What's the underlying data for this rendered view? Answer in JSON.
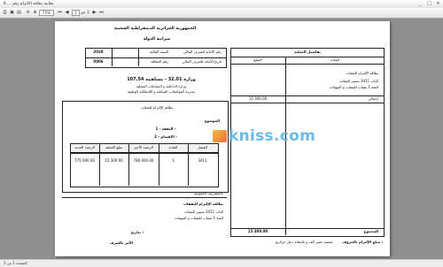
{
  "window": {
    "title": "معاينة بطاقة الالتزام رقم ... 6",
    "min": "_",
    "max": "□",
    "close": "✕"
  },
  "toolbar": {
    "zoom_value": "75%",
    "page_label": "من",
    "page_value": "1",
    "page_total": "1"
  },
  "status": {
    "page_indicator": "الصفحة 1 من 1"
  },
  "doc": {
    "republic": "الجمهورية الجزائرية الديمقراطية الشعبية",
    "budget_title": "ميزانية الدولة",
    "meta": [
      {
        "label": "رقم الأمانة للصرف المالي",
        "sublabel": "السنة المالية",
        "value": "2020"
      },
      {
        "label": "تاريخ الأمانة للصرف المالي",
        "sublabel": "رقم البطاقة",
        "value": "0006"
      }
    ],
    "ministry_line": "وزارة 32.01 - مساهمة 107.54",
    "ministry_sub1": "وزارة الداخلية و الجماعات المحلية",
    "ministry_sub2": "مديرية المواصلات السلكية و اللاسلكية الوطنية",
    "commit_card_box": "بطاقة الإلتزام للنفقات",
    "subject_label": "الموضوع",
    "part_line": "النفقة - 1 -",
    "section_line": "الاقسام - 2 -",
    "table_headers": [
      "الفصل",
      "المادة",
      "الرصيد الأخير",
      "مبلغ العملية",
      "الرصيد الجديد"
    ],
    "table_row": [
      "3411",
      "1",
      "780 000.00",
      "15 300.00",
      "775 000.00"
    ],
    "spending_label": "بالمصاريف العمومية",
    "card_title": "بطاقة الإلتزام للنفقات",
    "card_lines": [
      "الباب 3411 تسيير النفقات",
      "الفئة 1 نفقات للنفقات و المهمات"
    ],
    "date_label": "بتاريخ :",
    "orderer_label": "الآمر بالصرف",
    "right_panel_title": "تفاصيل العملية",
    "right_headers": [
      "المبلغ",
      "المادة"
    ],
    "right_entry_title": "بطاقة الإلتزام للنفقات",
    "right_entry_lines": [
      "الباب 3411 تسيير النفقات",
      "الفئة 1 نفقات للنفقات و المهمات"
    ],
    "right_amount": "15 300.00",
    "right_row_label": "إجمالي",
    "total_label": "المجموع",
    "total_value": "15 300.00",
    "words_label": "مبلغ الإلتزام بالحروف :",
    "words_value": "خمسة عشر ألف و ثلاثمائة دينار جزائري"
  }
}
